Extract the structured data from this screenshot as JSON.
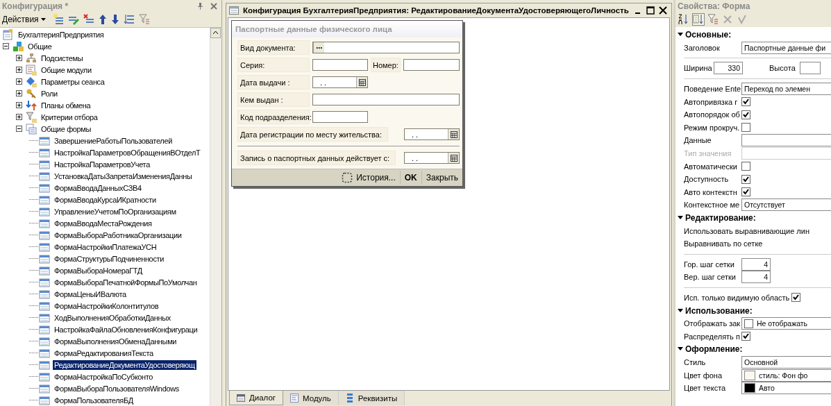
{
  "left_panel": {
    "title": "Конфигурация *",
    "actions_label": "Действия"
  },
  "tree": [
    {
      "label": "БухгалтерияПредприятия",
      "kind": "config",
      "selected": false,
      "children": [
        {
          "label": "Общие",
          "kind": "common",
          "selected": false,
          "expanded": true,
          "children": [
            {
              "label": "Подсистемы",
              "kind": "subsystems",
              "selected": false,
              "expanded": false
            },
            {
              "label": "Общие модули",
              "kind": "modules",
              "selected": false,
              "expanded": false
            },
            {
              "label": "Параметры сеанса",
              "kind": "session",
              "selected": false,
              "expanded": false
            },
            {
              "label": "Роли",
              "kind": "roles",
              "selected": false,
              "expanded": false
            },
            {
              "label": "Планы обмена",
              "kind": "exchange",
              "selected": false,
              "expanded": false
            },
            {
              "label": "Критерии отбора",
              "kind": "filter",
              "selected": false,
              "expanded": false
            },
            {
              "label": "Общие формы",
              "kind": "forms",
              "selected": false,
              "expanded": true,
              "children": [
                {
                  "label": "ЗавершениеРаботыПользователей",
                  "kind": "form",
                  "selected": false
                },
                {
                  "label": "НастройкаПараметровОбращенияВОтделТ",
                  "kind": "form",
                  "selected": false
                },
                {
                  "label": "НастройкаПараметровУчета",
                  "kind": "form",
                  "selected": false
                },
                {
                  "label": "УстановкаДатыЗапретаИзмененияДанны",
                  "kind": "form",
                  "selected": false
                },
                {
                  "label": "ФормаВводаДанныхСЗВ4",
                  "kind": "form",
                  "selected": false
                },
                {
                  "label": "ФормаВводаКурсаИКратности",
                  "kind": "form",
                  "selected": false
                },
                {
                  "label": "УправлениеУчетомПоОрганизациям",
                  "kind": "form",
                  "selected": false
                },
                {
                  "label": "ФормаВводаМестаРождения",
                  "kind": "form",
                  "selected": false
                },
                {
                  "label": "ФормаВыбораРаботникаОрганизации",
                  "kind": "form",
                  "selected": false
                },
                {
                  "label": "ФормаНастройкиПлатежаУСН",
                  "kind": "form",
                  "selected": false
                },
                {
                  "label": "ФормаСтруктурыПодчиненности",
                  "kind": "form",
                  "selected": false
                },
                {
                  "label": "ФормаВыбораНомераГТД",
                  "kind": "form",
                  "selected": false
                },
                {
                  "label": "ФормаВыбораПечатнойФормыПоУмолчан",
                  "kind": "form",
                  "selected": false
                },
                {
                  "label": "ФормаЦеныИВалюта",
                  "kind": "form",
                  "selected": false
                },
                {
                  "label": "ФормаНастройкиКолонтитулов",
                  "kind": "form",
                  "selected": false
                },
                {
                  "label": "ХодВыполненияОбработкиДанных",
                  "kind": "form",
                  "selected": false
                },
                {
                  "label": "НастройкаФайлаОбновленияКонфигураци",
                  "kind": "form",
                  "selected": false
                },
                {
                  "label": "ФормаВыполненияОбменаДанными",
                  "kind": "form",
                  "selected": false
                },
                {
                  "label": "ФормаРедактированияТекста",
                  "kind": "form",
                  "selected": false
                },
                {
                  "label": "РедактированиеДокументаУдостоверяющ",
                  "kind": "form",
                  "selected": true
                },
                {
                  "label": "ФормаНастройкаПоСубконто",
                  "kind": "form",
                  "selected": false
                },
                {
                  "label": "ФормаВыбораПользователяWindows",
                  "kind": "form",
                  "selected": false
                },
                {
                  "label": "ФормаПользователяБД",
                  "kind": "form",
                  "selected": false
                }
              ]
            }
          ]
        }
      ]
    }
  ],
  "window": {
    "title": "Конфигурация БухгалтерияПредприятия: РедактированиеДокументаУдостоверяющегоЛичность"
  },
  "form": {
    "title": "Паспортные данные физического лица",
    "rows": [
      {
        "kind": "fields",
        "items": [
          {
            "kind": "label",
            "text": "Вид документа:"
          },
          {
            "kind": "choice"
          }
        ]
      },
      {
        "kind": "fields",
        "items": [
          {
            "kind": "label",
            "text": "Серия:"
          },
          {
            "kind": "short-field"
          },
          {
            "kind": "inline-label",
            "text": "Номер:"
          },
          {
            "kind": "field"
          }
        ]
      },
      {
        "kind": "fields",
        "items": [
          {
            "kind": "label",
            "text": "Дата выдачи :"
          },
          {
            "kind": "date",
            "value": ". ."
          }
        ]
      },
      {
        "kind": "fields",
        "items": [
          {
            "kind": "label",
            "text": "Кем выдан :"
          },
          {
            "kind": "field"
          }
        ]
      },
      {
        "kind": "fields",
        "items": [
          {
            "kind": "label",
            "text": "Код подразделения:"
          },
          {
            "kind": "short-field"
          }
        ]
      },
      {
        "kind": "fields",
        "items": [
          {
            "kind": "long-label",
            "text": "Дата регистрации по месту жительства:"
          },
          {
            "kind": "date",
            "value": ". ."
          }
        ]
      },
      {
        "kind": "rule"
      },
      {
        "kind": "fields",
        "items": [
          {
            "kind": "long-label",
            "text": "Запись о паспортных данных действует с:"
          },
          {
            "kind": "date",
            "value": ". ."
          }
        ]
      }
    ],
    "buttons": [
      {
        "kind": "history",
        "label": "История..."
      },
      {
        "kind": "default",
        "label": "OK"
      },
      {
        "kind": "plain",
        "label": "Закрыть"
      }
    ]
  },
  "tabs": [
    {
      "label": "Диалог",
      "kind": "dialog",
      "selected": true
    },
    {
      "label": "Модуль",
      "kind": "module",
      "selected": false
    },
    {
      "label": "Реквизиты",
      "kind": "attributes",
      "selected": false
    }
  ],
  "properties_panel": {
    "title": "Свойства: Форма",
    "tools": [
      {
        "kind": "sort",
        "pressed": false,
        "disabled": false
      },
      {
        "kind": "group",
        "pressed": true,
        "disabled": false
      },
      {
        "kind": "filter",
        "pressed": false,
        "disabled": false
      },
      {
        "kind": "delete",
        "pressed": false,
        "disabled": true
      },
      {
        "kind": "apply",
        "pressed": false,
        "disabled": true
      }
    ]
  },
  "properties": [
    {
      "kind": "section",
      "label": "Основные:",
      "expanded": true
    },
    {
      "kind": "field",
      "label": "Заголовок",
      "value": "Паспортные данные фи"
    },
    {
      "kind": "pair",
      "label": "Ширина",
      "value": "330",
      "label_2": "Высота",
      "divider_before": true
    },
    {
      "kind": "field",
      "label": "Поведение Ente",
      "value": "Переход по элемен",
      "divider_before": true
    },
    {
      "kind": "check",
      "label": "Автопривязка г",
      "checked": true
    },
    {
      "kind": "check",
      "label": "Автопорядок об",
      "checked": true
    },
    {
      "kind": "check",
      "label": "Режим прокруч.",
      "checked": false
    },
    {
      "kind": "field",
      "label": "Данные"
    },
    {
      "kind": "field",
      "label": "Тип значения",
      "disabled": true
    },
    {
      "kind": "check",
      "label": "Автоматически",
      "checked": false
    },
    {
      "kind": "check",
      "label": "Доступность",
      "checked": true
    },
    {
      "kind": "check",
      "label": "Авто контекстн",
      "checked": true
    },
    {
      "kind": "field",
      "label": "Контекстное ме",
      "value": "Отсутствует"
    },
    {
      "kind": "section",
      "label": "Редактирование:",
      "expanded": true
    },
    {
      "kind": "plain",
      "label": "Использовать выравнивающие лин"
    },
    {
      "kind": "plain",
      "label": "Выравнивать по сетке"
    },
    {
      "kind": "number",
      "label": "Гор. шаг сетки",
      "value": "4",
      "divider_before": true
    },
    {
      "kind": "number",
      "label": "Вер. шаг сетки",
      "value": "4"
    },
    {
      "kind": "wide-check",
      "label": "Исп. только видимую область",
      "checked": true,
      "divider_before": true
    },
    {
      "kind": "section",
      "label": "Использование:",
      "expanded": true
    },
    {
      "kind": "check-field",
      "label": "Отображать зак",
      "checked": false,
      "value": "Не отображать"
    },
    {
      "kind": "check",
      "label": "Распределять п",
      "checked": true
    },
    {
      "kind": "section",
      "label": "Оформление:",
      "expanded": true
    },
    {
      "kind": "field",
      "label": "Стиль",
      "value": "Основной"
    },
    {
      "kind": "color",
      "label": "Цвет фона",
      "value": "стиль: Фон фо",
      "color": "#fbf8ef"
    },
    {
      "kind": "color",
      "label": "Цвет текста",
      "value": "Авто",
      "color": "#000000"
    }
  ]
}
